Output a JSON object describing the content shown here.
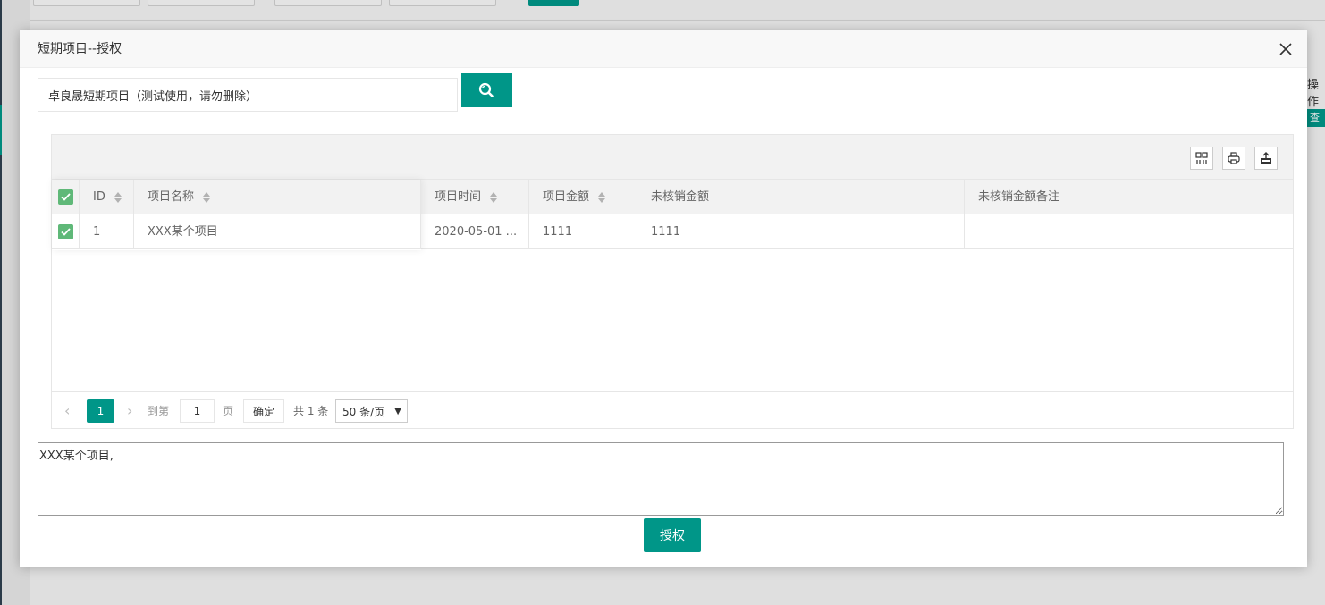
{
  "background": {
    "right_header_fragment": "操作",
    "right_button_fragment": "查"
  },
  "modal": {
    "title": "短期项目--授权",
    "close_icon": "close-icon"
  },
  "search": {
    "value": "卓良晟短期项目（测试使用，请勿删除）",
    "button_icon": "search-icon"
  },
  "toolbar": {
    "icons": [
      "columns-icon",
      "print-icon",
      "export-icon"
    ]
  },
  "table": {
    "columns": [
      "ID",
      "项目名称",
      "项目时间",
      "项目金额",
      "未核销金额",
      "未核销金额备注"
    ],
    "rows": [
      {
        "checked": true,
        "id": "1",
        "name": "XXX某个项目",
        "time": "2020-05-01 ...",
        "amount": "1111",
        "unverified": "1111",
        "remark": ""
      }
    ],
    "header_checked": true
  },
  "pagination": {
    "current_page": "1",
    "goto_label": "到第",
    "goto_value": "1",
    "page_unit": "页",
    "confirm_label": "确定",
    "total_text": "共 1 条",
    "page_size": "50 条/页"
  },
  "remark_text": "XXX某个项目,",
  "authorize_label": "授权",
  "colors": {
    "primary": "#009688",
    "checkbox": "#5fb878"
  }
}
